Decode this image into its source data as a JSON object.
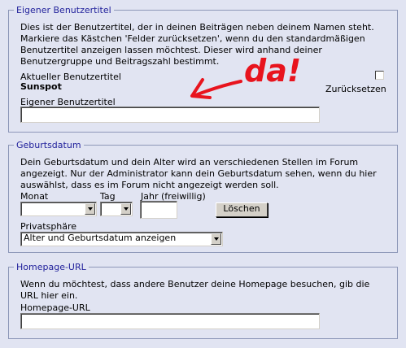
{
  "custom_title": {
    "legend": "Eigener Benutzertitel",
    "description": [
      "Dies ist der Benutzertitel, der in deinen Beiträgen neben deinem Namen steht.",
      "Markiere das Kästchen 'Felder zurücksetzen', wenn du den standardmäßigen",
      "Benutzertitel anzeigen lassen möchtest. Dieser wird anhand deiner",
      "Benutzergruppe und Beitragszahl bestimmt."
    ],
    "current_label": "Aktueller Benutzertitel",
    "current_value": "Sunspot",
    "reset_label": "Zurücksetzen",
    "reset_checked": false,
    "field_label": "Eigener Benutzertitel",
    "field_value": "",
    "annotation_text": "da!",
    "annotation_color": "#e8141e"
  },
  "birthday": {
    "legend": "Geburtsdatum",
    "description": [
      "Dein Geburtsdatum und dein Alter wird an verschiedenen Stellen im Forum",
      "angezeigt. Nur der Administrator kann dein Geburtsdatum sehen, wenn du hier",
      "auswählst, dass es im Forum nicht angezeigt werden soll."
    ],
    "month_label": "Monat",
    "month_value": "",
    "day_label": "Tag",
    "day_value": "",
    "year_label": "Jahr (freiwillig)",
    "year_value": "",
    "delete_button": "Löschen",
    "privacy_label": "Privatsphäre",
    "privacy_value": "Alter und Geburtsdatum anzeigen"
  },
  "homepage": {
    "legend": "Homepage-URL",
    "description": [
      "Wenn du möchtest, dass andere Benutzer deine Homepage besuchen, gib die",
      "URL hier ein."
    ],
    "field_label": "Homepage-URL",
    "field_value": ""
  },
  "colors": {
    "background": "#e1e4f2",
    "legend_text": "#22229c",
    "border": "#8d97b8"
  }
}
